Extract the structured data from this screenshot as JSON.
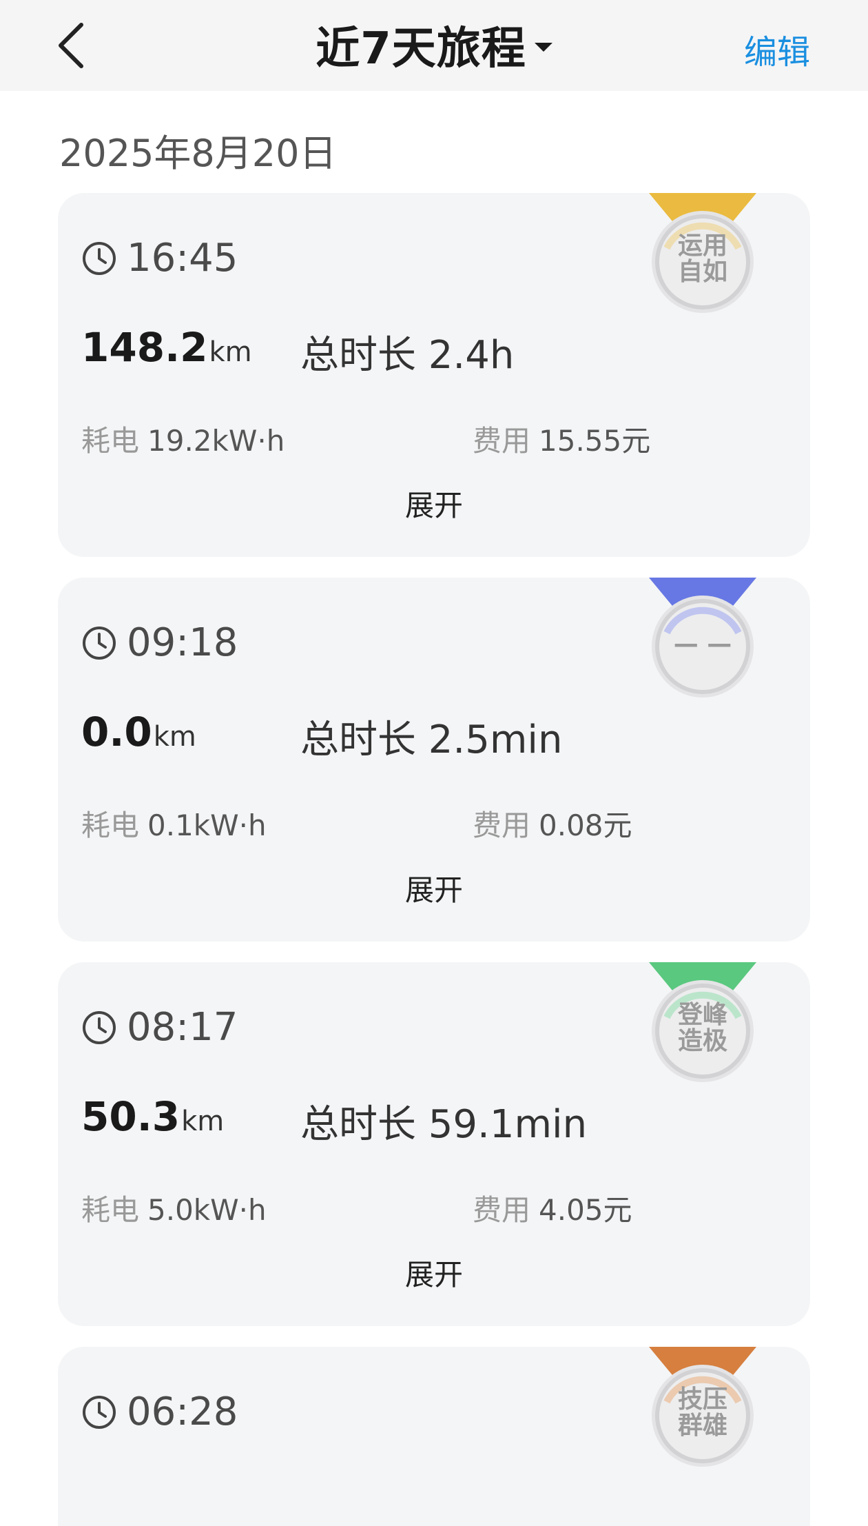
{
  "header": {
    "title": "近7天旅程",
    "edit_label": "编辑"
  },
  "date": "2025年8月20日",
  "trips": [
    {
      "time": "16:45",
      "distance": "148.2",
      "distance_unit": "km",
      "duration": "总时长 2.4h",
      "energy_label": "耗电",
      "energy_value": "19.2kW·h",
      "cost_label": "费用",
      "cost_value": "15.55元",
      "expand_label": "展开",
      "badge": {
        "line1": "运用",
        "line2": "自如",
        "color": "#e8b020"
      }
    },
    {
      "time": "09:18",
      "distance": "0.0",
      "distance_unit": "km",
      "duration": "总时长 2.5min",
      "energy_label": "耗电",
      "energy_value": "0.1kW·h",
      "cost_label": "费用",
      "cost_value": "0.08元",
      "expand_label": "展开",
      "badge": {
        "line1": "— —",
        "line2": "",
        "color": "#4d62e0"
      }
    },
    {
      "time": "08:17",
      "distance": "50.3",
      "distance_unit": "km",
      "duration": "总时长 59.1min",
      "energy_label": "耗电",
      "energy_value": "5.0kW·h",
      "cost_label": "费用",
      "cost_value": "4.05元",
      "expand_label": "展开",
      "badge": {
        "line1": "登峰",
        "line2": "造极",
        "color": "#3ec06a"
      }
    },
    {
      "time": "06:28",
      "badge": {
        "line1": "技压",
        "line2": "群雄",
        "color": "#d06a1e"
      }
    }
  ]
}
